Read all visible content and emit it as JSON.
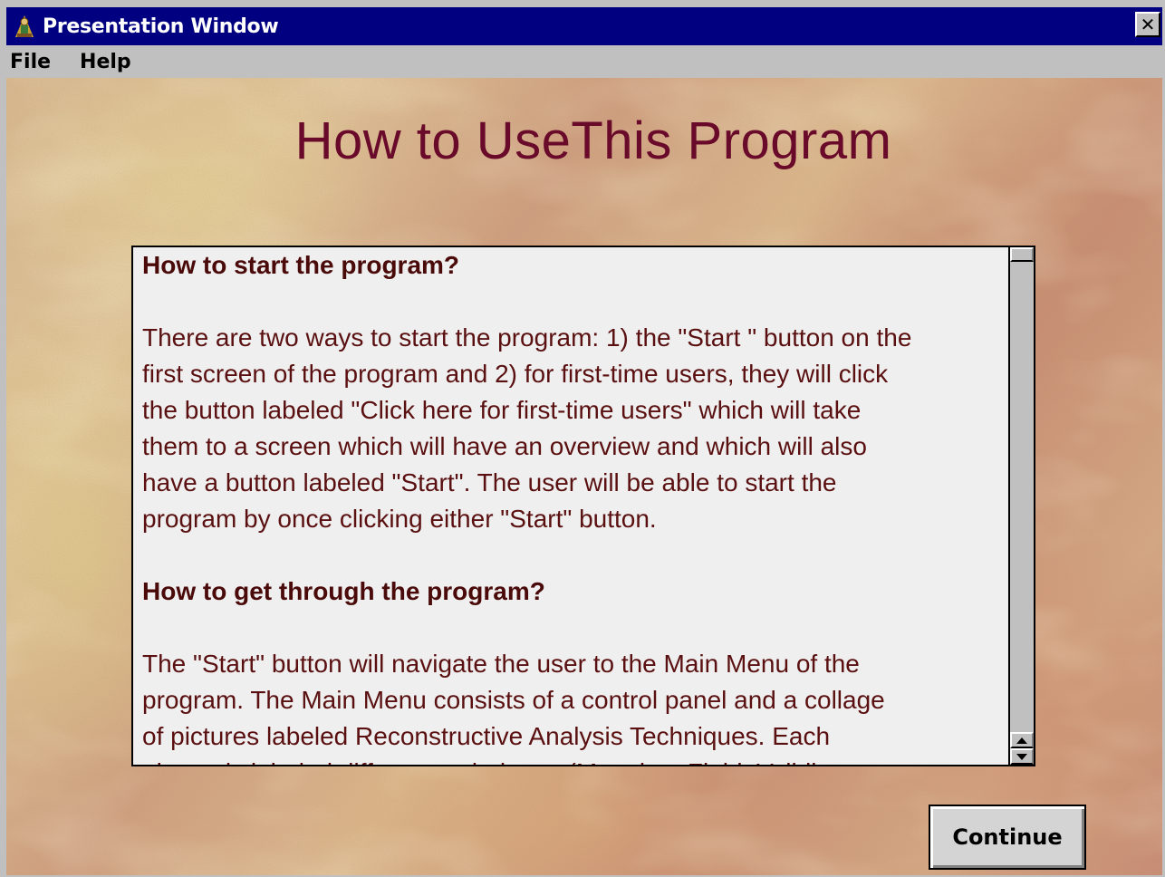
{
  "window": {
    "title": "Presentation Window",
    "close_symbol": "✕",
    "icon": "presentation-app-icon"
  },
  "menu": {
    "items": [
      "File",
      "Help"
    ]
  },
  "page": {
    "heading": "How to UseThis Program",
    "heading_color": "#6a0a2a"
  },
  "panel": {
    "sections": [
      {
        "heading": "How to start the program?",
        "body": "There are two ways to start the program: 1) the \"Start \" button on the\nfirst screen of the program and 2)  for first-time users, they will click\nthe button labeled \"Click here for first-time users\" which will take\nthem to a screen which will have an overview and which will also\nhave a button labeled \"Start\".  The user will be able to start the\nprogram by once clicking either \"Start\" button."
      },
      {
        "heading": "How to get through the program?",
        "body": "The \"Start\" button will navigate the user to the Main Menu of the\nprogram.  The Main Menu consists of a control panel and a collage\nof pictures labeled Reconstructive Analysis Techniques.  Each\npicture is labeled different techniques (Mapping, Field, Validity"
      }
    ],
    "scroll_position": 0
  },
  "buttons": {
    "continue": "Continue"
  }
}
